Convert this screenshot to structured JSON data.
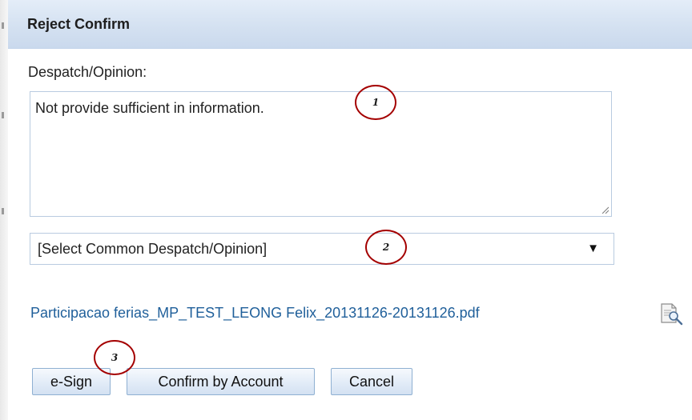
{
  "dialog": {
    "title": "Reject Confirm",
    "despatch_label": "Despatch/Opinion:",
    "despatch_value": "Not provide sufficient in information.",
    "common_select": {
      "selected": "[Select Common Despatch/Opinion]"
    },
    "attachment": {
      "filename": "Participacao ferias_MP_TEST_LEONG Felix_20131126-20131126.pdf",
      "icon": "document-search-icon"
    },
    "buttons": {
      "esign": "e-Sign",
      "confirm_by_account": "Confirm by Account",
      "cancel": "Cancel"
    }
  },
  "annotations": [
    "1",
    "2",
    "3"
  ],
  "colors": {
    "annotation_circle": "#a40000",
    "link": "#1f5f9a",
    "titlebar": "#d4e1f1"
  }
}
